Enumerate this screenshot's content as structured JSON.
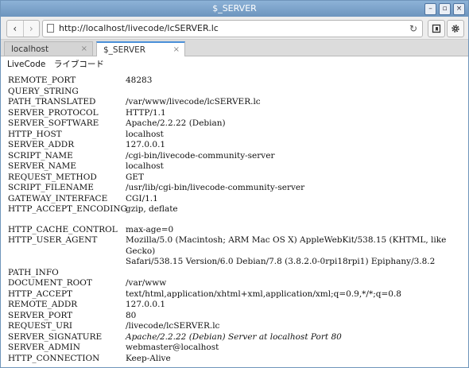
{
  "window": {
    "title": "$_SERVER",
    "controls": [
      "–",
      "▫",
      "×"
    ]
  },
  "toolbar": {
    "back_icon": "‹",
    "forward_icon": "›",
    "url": "http://localhost/livecode/lcSERVER.lc",
    "reload_icon": "↻",
    "bookmark_icon": "bookmark-icon",
    "settings_icon": "gear-icon"
  },
  "tabs": [
    {
      "label": "localhost",
      "close": "×"
    },
    {
      "label": "$_SERVER",
      "close": "×"
    }
  ],
  "page": {
    "header": "LiveCode　ライブコード",
    "rows": [
      {
        "key": "REMOTE_PORT",
        "value": "48283"
      },
      {
        "key": "QUERY_STRING",
        "value": ""
      },
      {
        "key": "PATH_TRANSLATED",
        "value": "/var/www/livecode/lcSERVER.lc"
      },
      {
        "key": "SERVER_PROTOCOL",
        "value": "HTTP/1.1"
      },
      {
        "key": "SERVER_SOFTWARE",
        "value": "Apache/2.2.22 (Debian)"
      },
      {
        "key": "HTTP_HOST",
        "value": "localhost"
      },
      {
        "key": "SERVER_ADDR",
        "value": "127.0.0.1"
      },
      {
        "key": "SCRIPT_NAME",
        "value": "/cgi-bin/livecode-community-server"
      },
      {
        "key": "SERVER_NAME",
        "value": "localhost"
      },
      {
        "key": "REQUEST_METHOD",
        "value": "GET"
      },
      {
        "key": "SCRIPT_FILENAME",
        "value": "/usr/lib/cgi-bin/livecode-community-server"
      },
      {
        "key": "GATEWAY_INTERFACE",
        "value": "CGI/1.1"
      },
      {
        "key": "HTTP_ACCEPT_ENCODING",
        "value": "gzip, deflate"
      },
      {
        "key": "HTTP_CACHE_CONTROL",
        "value": "max-age=0"
      },
      {
        "key": "HTTP_USER_AGENT",
        "value": "Mozilla/5.0 (Macintosh; ARM Mac OS X) AppleWebKit/538.15 (KHTML, like Gecko)\nSafari/538.15 Version/6.0 Debian/7.8 (3.8.2.0-0rpi18rpi1) Epiphany/3.8.2"
      },
      {
        "key": "PATH_INFO",
        "value": ""
      },
      {
        "key": "DOCUMENT_ROOT",
        "value": "/var/www"
      },
      {
        "key": "HTTP_ACCEPT",
        "value": "text/html,application/xhtml+xml,application/xml;q=0.9,*/*;q=0.8"
      },
      {
        "key": "REMOTE_ADDR",
        "value": "127.0.0.1"
      },
      {
        "key": "SERVER_PORT",
        "value": "80"
      },
      {
        "key": "REQUEST_URI",
        "value": "/livecode/lcSERVER.lc"
      },
      {
        "key": "SERVER_SIGNATURE",
        "value": "Apache/2.2.22 (Debian) Server at localhost Port 80"
      },
      {
        "key": "SERVER_ADMIN",
        "value": "webmaster@localhost"
      },
      {
        "key": "HTTP_CONNECTION",
        "value": "Keep-Alive"
      }
    ]
  }
}
